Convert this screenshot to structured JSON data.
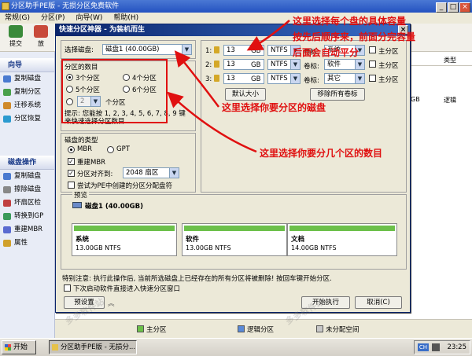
{
  "app": {
    "title": "分区助手PE版 - 无损分区免费软件"
  },
  "menu": [
    "常规(G)",
    "分区(P)",
    "向导(W)",
    "帮助(H)"
  ],
  "toolbar": {
    "commit": "提交",
    "discard": "放"
  },
  "sidebar": {
    "wizard_header": "向导",
    "wizard_items": [
      "复制磁盘",
      "复制分区",
      "迁移系统",
      "分区恢复"
    ],
    "ops_header": "磁盘操作",
    "ops_items": [
      "复制磁盘",
      "擦除磁盘",
      "坏扇区检",
      "转换到GP",
      "重建MBR",
      "属性"
    ]
  },
  "rightpane": {
    "col_type": "类型",
    "row1_gb": "GB",
    "row1_type": "逻辑"
  },
  "legend": {
    "primary": "主分区",
    "logical": "逻辑分区",
    "unallocated": "未分配空间"
  },
  "taskbar": {
    "start": "开始",
    "task": "分区助手PE版 - 无损分...",
    "clock": "23:25",
    "lang": "CH"
  },
  "dialog": {
    "title": "快速分区神器 - 为装机而生",
    "select_disk_label": "选择磁盘:",
    "select_disk_value": "磁盘1 (40.00GB)",
    "count_group_label": "分区的数目",
    "count_options": [
      "3个分区",
      "4个分区",
      "5个分区",
      "6个分区"
    ],
    "custom_count_value": "2",
    "custom_count_suffix": "个分区",
    "tip": "提示: 您能按 1, 2, 3, 4, 5, 6, 7, 8, 9 键来快速选择分区数目.",
    "disk_type_label": "磁盘的类型",
    "mbr": "MBR",
    "gpt": "GPT",
    "rebuild_mbr": "重建MBR",
    "align_label": "分区对齐到:",
    "align_value": "2048 扇区",
    "pe_assign": "尝试为PE中创建的分区分配盘符",
    "rows": [
      {
        "n": "1:",
        "size": "13",
        "unit": "GB",
        "fs": "NTFS",
        "label_name": "卷标:",
        "label_value": "系统",
        "primary": "主分区"
      },
      {
        "n": "2:",
        "size": "13",
        "unit": "GB",
        "fs": "NTFS",
        "label_name": "卷标:",
        "label_value": "软件",
        "primary": "主分区"
      },
      {
        "n": "3:",
        "size": "13",
        "unit": "GB",
        "fs": "NTFS",
        "label_name": "卷标:",
        "label_value": "其它",
        "primary": "主分区"
      }
    ],
    "default_size_btn": "默认大小",
    "remove_labels_btn": "移除所有卷标",
    "preview_label": "预览",
    "preview_disk": "磁盘1 (40.00GB)",
    "partitions": [
      {
        "name": "系统",
        "size": "13.00GB NTFS"
      },
      {
        "name": "软件",
        "size": "13.00GB NTFS"
      },
      {
        "name": "文档",
        "size": "14.00GB NTFS"
      }
    ],
    "notice": "特别注意: 执行此操作后, 当前所选磁盘上已经存在的所有分区将被删除! 按回车键开始分区.",
    "enter_pe_quick": "下次启动软件直接进入快速分区窗口",
    "preset_btn": "预设置",
    "execute_btn": "开始执行",
    "cancel_btn": "取消(C)"
  },
  "annotations": {
    "capacity_line1": "这里选择每个盘的具体容量",
    "capacity_line2": "按先后顺序来，前面分完容量",
    "capacity_line3": "后面会自动平分",
    "disk_note": "这里选择你要分区的磁盘",
    "count_note": "这里选择你要分几个区的数目"
  },
  "watermark": "多多软件站"
}
